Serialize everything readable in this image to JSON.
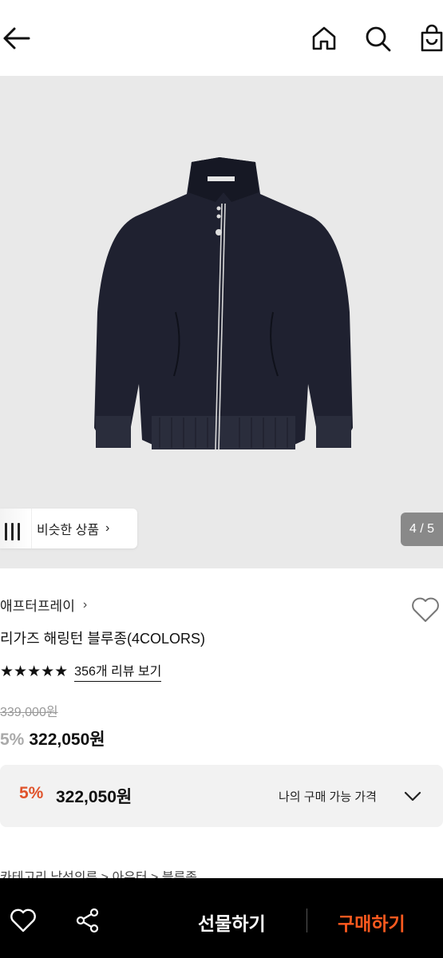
{
  "header": {
    "back_icon": "arrow-left-icon",
    "home_icon": "home-icon",
    "search_icon": "search-icon",
    "bag_icon": "shopping-bag-icon"
  },
  "gallery": {
    "similar_label": "비슷한 상품",
    "similar_chevron": "›",
    "counter": "4 / 5",
    "jacket_color": "#1f2130"
  },
  "product": {
    "brand": "애프터프레이",
    "brand_chevron": "›",
    "title": "리가즈 해링턴 블루종(4COLORS)",
    "stars": "★★★★★",
    "rating_value": 5,
    "review_link": "356개 리뷰 보기",
    "original_price": "339,000원",
    "discount_pct": "5%",
    "sale_price": "322,050원"
  },
  "my_price": {
    "discount_pct": "5%",
    "price": "322,050원",
    "label": "나의 구매 가능 가격",
    "accent_color": "#e0532b"
  },
  "category": {
    "text": "카테고리      남성의류  >  아우터  >  블루종"
  },
  "bottom_bar": {
    "gift_label": "선물하기",
    "buy_label": "구매하기",
    "buy_color": "#ff5a1f"
  }
}
